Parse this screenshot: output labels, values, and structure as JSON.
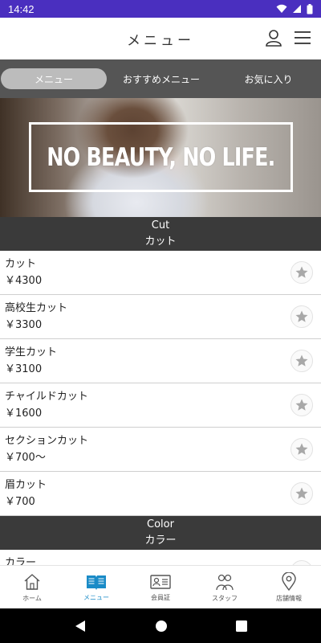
{
  "statusbar": {
    "time": "14:42"
  },
  "appbar": {
    "title": "メニュー"
  },
  "tabs": [
    {
      "label": "メニュー",
      "active": true
    },
    {
      "label": "おすすめメニュー",
      "active": false
    },
    {
      "label": "お気に入り",
      "active": false
    }
  ],
  "banner": {
    "text": "NO BEAUTY, NO LIFE."
  },
  "sections": [
    {
      "title_en": "Cut",
      "title_ja": "カット",
      "items": [
        {
          "name": "カット",
          "price": "￥4300"
        },
        {
          "name": "高校生カット",
          "price": "￥3300"
        },
        {
          "name": "学生カット",
          "price": "￥3100"
        },
        {
          "name": "チャイルドカット",
          "price": "￥1600"
        },
        {
          "name": "セクションカット",
          "price": "￥700〜"
        },
        {
          "name": "眉カット",
          "price": "￥700"
        }
      ]
    },
    {
      "title_en": "Color",
      "title_ja": "カラー",
      "items": [
        {
          "name": "カラー",
          "price": ""
        }
      ]
    }
  ],
  "bottomnav": [
    {
      "label": "ホーム",
      "icon": "home-icon",
      "active": false
    },
    {
      "label": "メニュー",
      "icon": "book-icon",
      "active": true
    },
    {
      "label": "会員証",
      "icon": "member-card-icon",
      "active": false
    },
    {
      "label": "スタッフ",
      "icon": "staff-icon",
      "active": false
    },
    {
      "label": "店舗情報",
      "icon": "location-pin-icon",
      "active": false
    }
  ],
  "colors": {
    "statusbar": "#4a2fbf",
    "tabbar": "#555555",
    "section": "#3a3a3a",
    "accent": "#1a8bc7"
  }
}
